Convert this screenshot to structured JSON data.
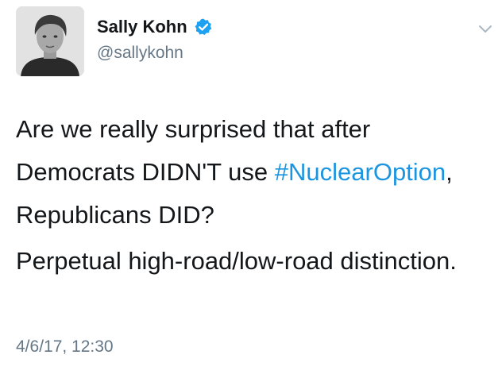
{
  "author": {
    "display_name": "Sally Kohn",
    "handle": "@sallykohn",
    "verified": true
  },
  "tweet": {
    "line1_before": "Are we really surprised that after Democrats DIDN'T use ",
    "hashtag": "#NuclearOption",
    "line1_after": ", Republicans DID?",
    "paragraph2": "Perpetual high-road/low-road distinction.",
    "timestamp": "4/6/17, 12:30"
  },
  "icons": {
    "verified": "verified-badge-icon",
    "menu": "chevron-down-icon"
  },
  "colors": {
    "link": "#1b95e0",
    "verified": "#1da1f2",
    "secondary_text": "#657786",
    "primary_text": "#14171a"
  }
}
